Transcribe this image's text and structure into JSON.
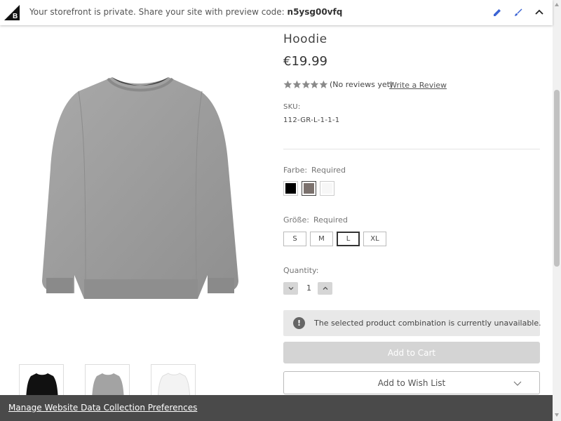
{
  "banner": {
    "message": "Your storefront is private. Share your site with preview code:",
    "preview_code": "n5ysg00vfq"
  },
  "product": {
    "title": "Hoodie",
    "price": "€19.99",
    "rating": {
      "stars": 5,
      "filled": 0
    },
    "reviews_text": "(No reviews yet)",
    "write_review": "Write a Review",
    "sku_label": "SKU:",
    "sku_value": "112-GR-L-1-1-1"
  },
  "options": {
    "color": {
      "label": "Farbe:",
      "required": "Required",
      "swatches": [
        {
          "name": "black",
          "color": "#000000",
          "selected": false
        },
        {
          "name": "grey-brown",
          "color": "#7b716d",
          "selected": true
        },
        {
          "name": "white",
          "color": "#f7f7f7",
          "selected": false
        }
      ]
    },
    "size": {
      "label": "Größe:",
      "required": "Required",
      "sizes": [
        {
          "label": "S",
          "selected": false
        },
        {
          "label": "M",
          "selected": false
        },
        {
          "label": "L",
          "selected": true
        },
        {
          "label": "XL",
          "selected": false
        }
      ]
    }
  },
  "quantity": {
    "label": "Quantity:",
    "value": "1"
  },
  "alert": {
    "icon": "!",
    "text": "The selected product combination is currently unavailable."
  },
  "buttons": {
    "add_to_cart": "Add to Cart",
    "add_to_wishlist": "Add to Wish List"
  },
  "cookie_bar": {
    "link": "Manage Website Data Collection Preferences"
  },
  "colors": {
    "accent_blue": "#3c64d4",
    "disabled_button": "#d4d4d4",
    "cookie_bar": "#4a4a4a"
  },
  "icons": [
    "bigcommerce-logo-icon",
    "pencil-icon",
    "brush-icon",
    "chevron-up-icon",
    "star-icon",
    "chevron-down-icon",
    "chevron-up-icon",
    "exclamation-icon"
  ]
}
